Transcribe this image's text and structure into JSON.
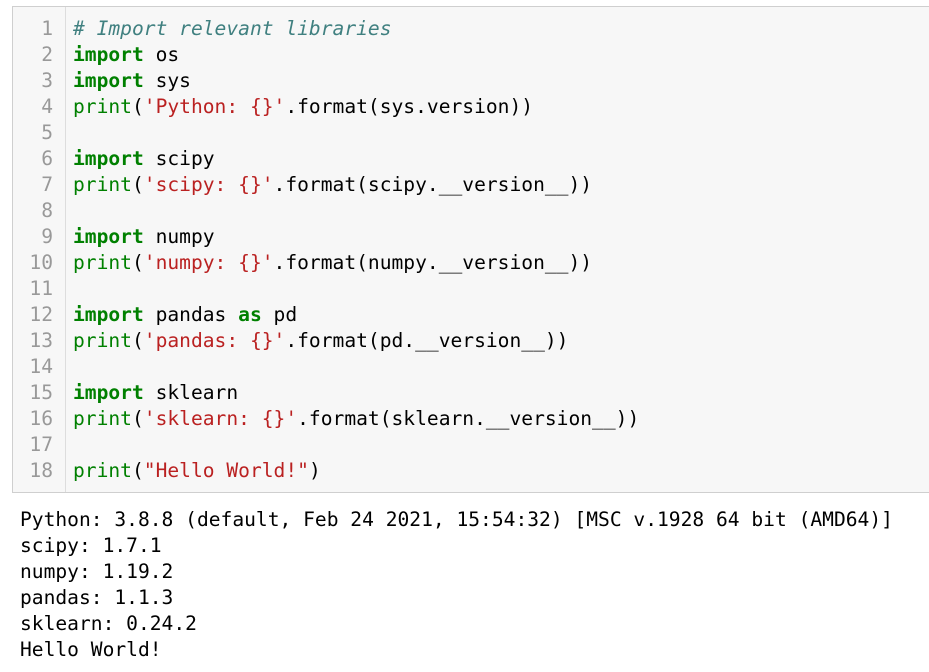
{
  "input": {
    "lines": [
      {
        "n": "1",
        "tokens": [
          {
            "c": "cm",
            "t": "# Import relevant libraries"
          }
        ]
      },
      {
        "n": "2",
        "tokens": [
          {
            "c": "kw",
            "t": "import"
          },
          {
            "c": "",
            "t": " os"
          }
        ]
      },
      {
        "n": "3",
        "tokens": [
          {
            "c": "kw",
            "t": "import"
          },
          {
            "c": "",
            "t": " sys"
          }
        ]
      },
      {
        "n": "4",
        "tokens": [
          {
            "c": "bi",
            "t": "print"
          },
          {
            "c": "",
            "t": "("
          },
          {
            "c": "str",
            "t": "'Python: {}'"
          },
          {
            "c": "",
            "t": ".format(sys.version))"
          }
        ]
      },
      {
        "n": "5",
        "tokens": []
      },
      {
        "n": "6",
        "tokens": [
          {
            "c": "kw",
            "t": "import"
          },
          {
            "c": "",
            "t": " scipy"
          }
        ]
      },
      {
        "n": "7",
        "tokens": [
          {
            "c": "bi",
            "t": "print"
          },
          {
            "c": "",
            "t": "("
          },
          {
            "c": "str",
            "t": "'scipy: {}'"
          },
          {
            "c": "",
            "t": ".format(scipy.__version__))"
          }
        ]
      },
      {
        "n": "8",
        "tokens": []
      },
      {
        "n": "9",
        "tokens": [
          {
            "c": "kw",
            "t": "import"
          },
          {
            "c": "",
            "t": " numpy"
          }
        ]
      },
      {
        "n": "10",
        "tokens": [
          {
            "c": "bi",
            "t": "print"
          },
          {
            "c": "",
            "t": "("
          },
          {
            "c": "str",
            "t": "'numpy: {}'"
          },
          {
            "c": "",
            "t": ".format(numpy.__version__))"
          }
        ]
      },
      {
        "n": "11",
        "tokens": []
      },
      {
        "n": "12",
        "tokens": [
          {
            "c": "kw",
            "t": "import"
          },
          {
            "c": "",
            "t": " pandas "
          },
          {
            "c": "kw",
            "t": "as"
          },
          {
            "c": "",
            "t": " pd"
          }
        ]
      },
      {
        "n": "13",
        "tokens": [
          {
            "c": "bi",
            "t": "print"
          },
          {
            "c": "",
            "t": "("
          },
          {
            "c": "str",
            "t": "'pandas: {}'"
          },
          {
            "c": "",
            "t": ".format(pd.__version__))"
          }
        ]
      },
      {
        "n": "14",
        "tokens": []
      },
      {
        "n": "15",
        "tokens": [
          {
            "c": "kw",
            "t": "import"
          },
          {
            "c": "",
            "t": " sklearn"
          }
        ]
      },
      {
        "n": "16",
        "tokens": [
          {
            "c": "bi",
            "t": "print"
          },
          {
            "c": "",
            "t": "("
          },
          {
            "c": "str",
            "t": "'sklearn: {}'"
          },
          {
            "c": "",
            "t": ".format(sklearn.__version__))"
          }
        ]
      },
      {
        "n": "17",
        "tokens": []
      },
      {
        "n": "18",
        "tokens": [
          {
            "c": "bi",
            "t": "print"
          },
          {
            "c": "",
            "t": "("
          },
          {
            "c": "str",
            "t": "\"Hello World!\""
          },
          {
            "c": "",
            "t": ")"
          }
        ]
      }
    ]
  },
  "output": {
    "lines": [
      "Python: 3.8.8 (default, Feb 24 2021, 15:54:32) [MSC v.1928 64 bit (AMD64)]",
      "scipy: 1.7.1",
      "numpy: 1.19.2",
      "pandas: 1.1.3",
      "sklearn: 0.24.2",
      "Hello World!"
    ]
  },
  "colors": {
    "keyword": "#008000",
    "string": "#ba2121",
    "comment": "#408080",
    "line_number": "#999999",
    "cell_background": "#f7f7f7"
  }
}
